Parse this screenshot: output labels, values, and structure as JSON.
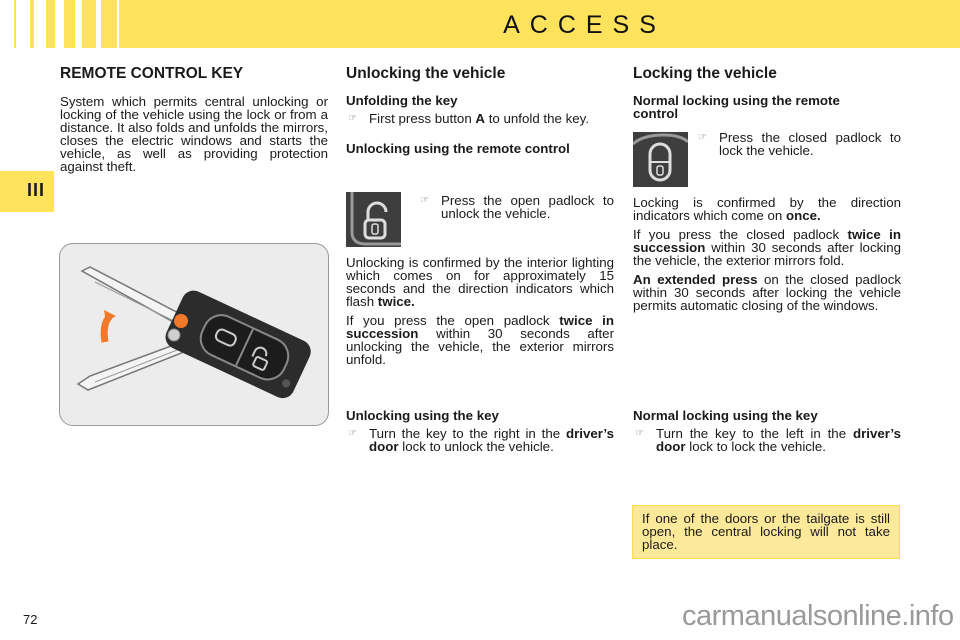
{
  "header": {
    "title": "ACCESS"
  },
  "chapter_tab": {
    "label": "III"
  },
  "left": {
    "title": "REMOTE CONTROL KEY",
    "intro": "System which permits central unlocking or locking of the vehicle using the lock or from a distance. It also folds and unfolds the mirrors, closes the electric windows and starts the vehicle, as well as providing protection against theft.",
    "image_alt": "Remote control key with folding blade"
  },
  "unlocking": {
    "title": "Unlocking the vehicle",
    "unfold_heading": "Unfolding the key",
    "unfold_pre": "First press button ",
    "unfold_bold": "A",
    "unfold_post": " to unfold the key.",
    "remote_heading": "Unlocking using the remote control",
    "remote_bullet": "Press the open padlock to unlock the vehicle.",
    "confirm_pre": "Unlocking is confirmed by the interior lighting which comes on for approximately 15 seconds and the direction indicators which flash ",
    "confirm_bold": "twice.",
    "twice_pre": "If you press the open padlock ",
    "twice_bold": "twice in succession",
    "twice_post": " within 30 seconds after unlocking the vehicle, the exterior mirrors unfold.",
    "key_heading": "Unlocking using the key",
    "key_pre": "Turn the key to the right in the ",
    "key_bold": "driver’s door",
    "key_post": " lock to unlock the vehicle."
  },
  "locking": {
    "title": "Locking the vehicle",
    "remote_heading": "Normal locking using the remote control",
    "remote_bullet": "Press the closed padlock to lock the vehicle.",
    "confirm_pre": "Locking is confirmed by the direction indicators which come on ",
    "confirm_bold": "once.",
    "twice_pre": "If you press the closed padlock ",
    "twice_bold": "twice in succession",
    "twice_post": " within 30 seconds after locking the vehicle, the exterior mirrors fold.",
    "extended_bold": "An extended press",
    "extended_post": " on the closed padlock within 30 seconds after locking the vehicle permits automatic closing of the windows.",
    "key_heading": "Normal locking using the key",
    "key_pre": "Turn the key to the left in the ",
    "key_bold": "driver’s door",
    "key_post": " lock to lock the vehicle."
  },
  "note": {
    "text": "If one of the doors or the tailgate is still open, the central locking will not take place."
  },
  "footer": {
    "page_number": "72",
    "watermark": "carmanualsonline.info"
  },
  "icons": {
    "bullet": "pointing-hand-icon",
    "unlock": "open-padlock-icon",
    "lock": "closed-padlock-icon"
  },
  "colors": {
    "accent": "#ffe35c",
    "note_bg": "#fde99a",
    "orange": "#f07a2a"
  }
}
